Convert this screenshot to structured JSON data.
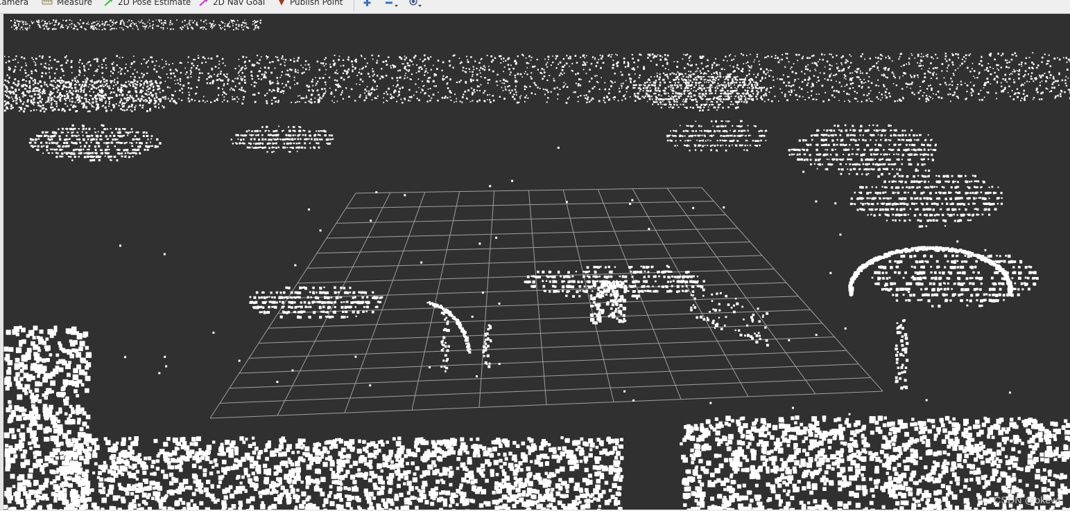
{
  "toolbar": {
    "tools": [
      {
        "label": "Camera",
        "icon": "camera-icon"
      },
      {
        "label": "Measure",
        "icon": "ruler-icon"
      },
      {
        "label": "2D Pose Estimate",
        "icon": "green-arrow-icon"
      },
      {
        "label": "2D Nav Goal",
        "icon": "magenta-arrow-icon"
      },
      {
        "label": "Publish Point",
        "icon": "red-pin-icon"
      }
    ],
    "icon_buttons": [
      "add-tool-icon",
      "remove-tool-icon",
      "camera-view-icon"
    ]
  },
  "viewport": {
    "background": "#303030",
    "grid_color": "#a0a0a0",
    "points_color": "#ffffff"
  },
  "watermark": "CSDN @okewi"
}
